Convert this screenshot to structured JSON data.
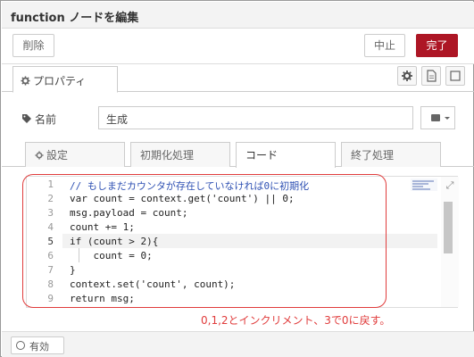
{
  "dialog": {
    "title": "function ノードを編集",
    "delete_label": "削除",
    "cancel_label": "中止",
    "done_label": "完了",
    "done_color": "#ad1625"
  },
  "properties_tab": {
    "label": "プロパティ"
  },
  "icons": {
    "properties": "gear-icon",
    "settings": "gear-icon",
    "description": "document-icon",
    "appearance": "frame-icon",
    "name_tag": "tag-icon",
    "name_button": "book-icon",
    "expand": "expand-icon"
  },
  "name_field": {
    "label": "名前",
    "value": "生成"
  },
  "tabs": [
    {
      "label": "設定"
    },
    {
      "label": "初期化処理"
    },
    {
      "label": "コード"
    },
    {
      "label": "終了処理"
    }
  ],
  "code": {
    "lines": [
      {
        "n": "1",
        "text": "// もしまだカウンタが存在していなければ0に初期化"
      },
      {
        "n": "2",
        "text": "var count = context.get('count') || 0;"
      },
      {
        "n": "3",
        "text": "msg.payload = count;"
      },
      {
        "n": "4",
        "text": "count += 1;"
      },
      {
        "n": "5",
        "text": "if (count > 2){"
      },
      {
        "n": "6",
        "text": "    count = 0;"
      },
      {
        "n": "7",
        "text": "}"
      },
      {
        "n": "8",
        "text": "context.set('count', count);"
      },
      {
        "n": "9",
        "text": "return msg;"
      }
    ]
  },
  "annotation": {
    "text": "0,1,2とインクリメント、3で0に戻す。",
    "color": "#e03c3c"
  },
  "footer": {
    "enable_label": "有効"
  }
}
